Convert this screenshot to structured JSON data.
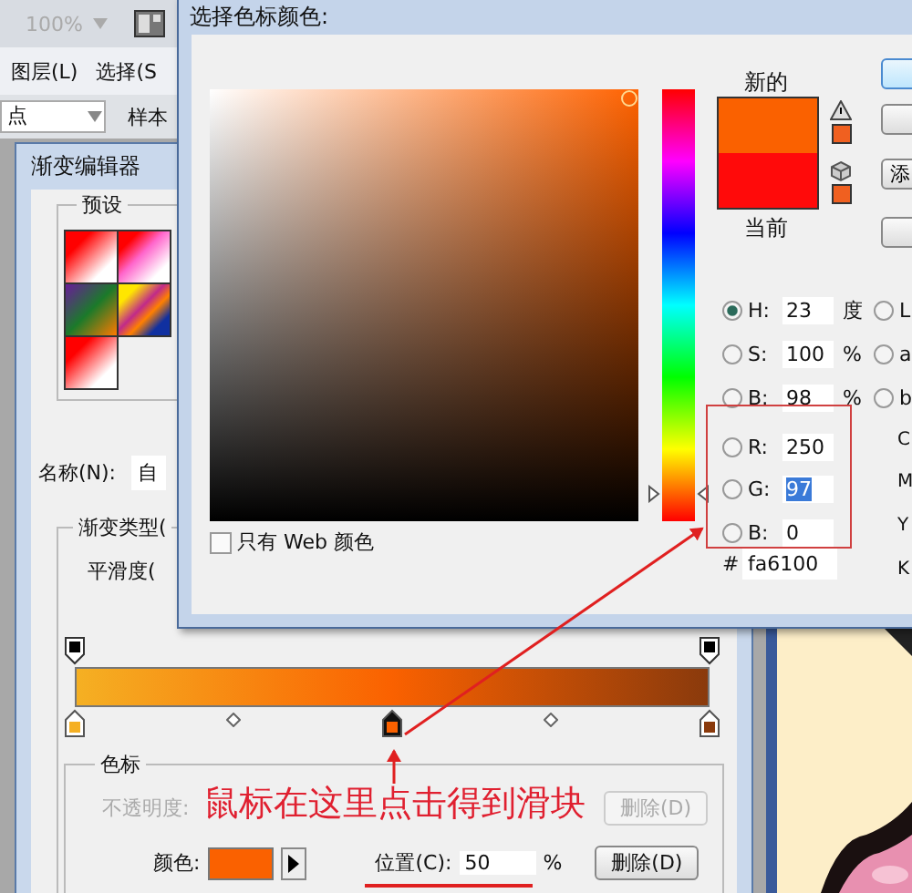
{
  "app": {
    "zoom": "100%",
    "menu": [
      "图层(L)",
      "选择(S"
    ],
    "options_field": "点",
    "options_label": "样本"
  },
  "gradient_editor": {
    "title": "渐变编辑器",
    "presets_label": "预设",
    "name_label": "名称(N):",
    "name_value": "自",
    "type_label": "渐变类型(",
    "smoothness_label": "平滑度(",
    "opacity_stops": [
      {
        "selected": false
      },
      {
        "selected": false
      }
    ],
    "color_stops": [
      {
        "color": "#f5b023",
        "selected": false
      },
      {
        "color": "#fa6100",
        "selected": true
      },
      {
        "color": "#8a3a0c",
        "selected": false
      }
    ],
    "stops_group": {
      "label": "色标",
      "opacity_label": "不透明度:",
      "opacity_delete": {
        "label": "删除(D)",
        "disabled": true
      },
      "color_label": "颜色:",
      "location_label": "位置(C):",
      "location": "50",
      "percent": "%",
      "delete": {
        "label": "删除(D)",
        "disabled": false
      }
    }
  },
  "annotation": {
    "text": "鼠标在这里点击得到滑块"
  },
  "color_picker": {
    "title": "选择色标颜色:",
    "new_label": "新的",
    "current_label": "当前",
    "button_label": "添",
    "hue_slider": {
      "level": 0.064
    },
    "fields": [
      {
        "label": "H:",
        "value": "23",
        "unit": "度",
        "selected": true,
        "highlighted": false
      },
      {
        "label": "S:",
        "value": "100",
        "unit": "%",
        "selected": false,
        "highlighted": false
      },
      {
        "label": "B:",
        "value": "98",
        "unit": "%",
        "selected": false,
        "highlighted": false
      },
      {
        "label": "R:",
        "value": "250",
        "selected": false,
        "highlighted": false
      },
      {
        "label": "G:",
        "value": "97",
        "selected": false,
        "highlighted": true
      },
      {
        "label": "B:",
        "value": "0",
        "selected": false,
        "highlighted": false
      }
    ],
    "lab": [
      {
        "label": "L",
        "selected": false
      },
      {
        "label": "a",
        "selected": false
      },
      {
        "label": "b",
        "selected": false
      }
    ],
    "cmyk_labels": [
      "C",
      "M",
      "Y",
      "K"
    ],
    "hex_label": "#",
    "hex": "fa6100",
    "web_only": {
      "label": "只有 Web 颜色",
      "checked": false
    }
  }
}
